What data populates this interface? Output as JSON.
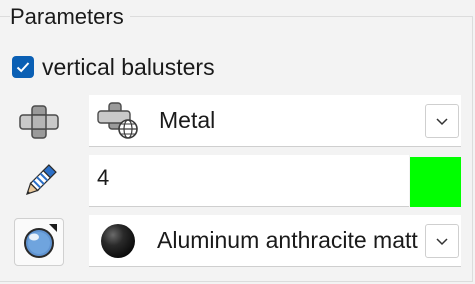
{
  "group": {
    "title": "Parameters"
  },
  "checkbox": {
    "label": "vertical balusters",
    "checked": true
  },
  "material": {
    "value": "Metal",
    "icon": "material-library-icon"
  },
  "count": {
    "value": "4",
    "color": "#00ff00"
  },
  "surface": {
    "value": "Aluminum anthracite matt",
    "icon": "sphere-icon"
  },
  "colors": {
    "accent": "#0a5fb4",
    "swatch": "#00ff00"
  }
}
